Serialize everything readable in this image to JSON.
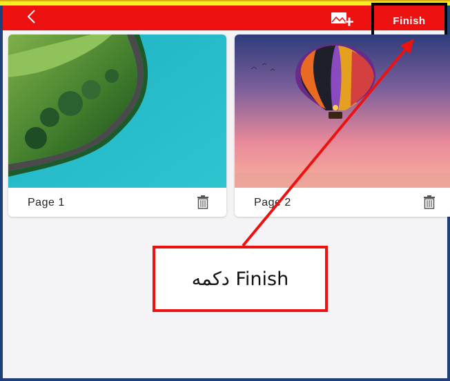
{
  "toolbar": {
    "back_icon": "chevron-left-icon",
    "add_image_icon": "add-image-icon",
    "finish_label": "Finish"
  },
  "pages": [
    {
      "label": "Page 1",
      "image": "coastal-road-photo",
      "delete_icon": "trash-icon"
    },
    {
      "label": "Page 2",
      "image": "hot-air-balloon-photo",
      "delete_icon": "trash-icon"
    }
  ],
  "annotation": {
    "callout_text": "دکمه Finish"
  },
  "colors": {
    "toolbar_bg": "#ee1111",
    "background": "#f4f4f6",
    "annotation_red": "#ee1111",
    "highlight_border": "#000000",
    "top_strip": "#f5ef1d"
  }
}
